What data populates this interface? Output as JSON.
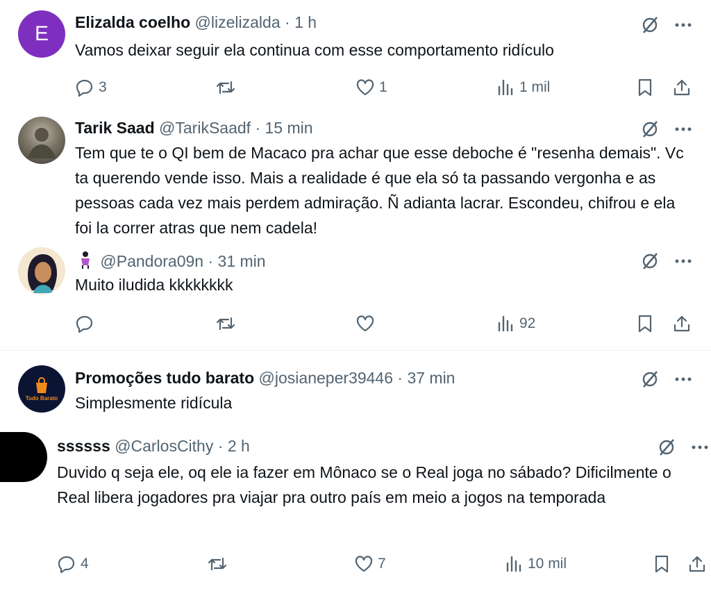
{
  "colors": {
    "text": "#0f1419",
    "muted": "#536471",
    "purple_avatar": "#7e2fbf"
  },
  "posts": [
    {
      "name": "Elizalda coelho",
      "handle": "@lizelizalda",
      "dot": "·",
      "time": "1 h",
      "avatar_letter": "E",
      "text": "Vamos deixar seguir ela continua com esse comportamento ridículo",
      "replies": "3",
      "reposts": "",
      "likes": "1",
      "views": "1 mil"
    },
    {
      "name": "Tarik Saad",
      "handle": "@TarikSaadf",
      "dot": "·",
      "time": "15 min",
      "text": "Tem que te o QI bem de Macaco pra achar que esse deboche é \"resenha demais\". Vc ta querendo vende isso. Mais a realidade é que ela só ta passando vergonha e as pessoas cada vez mais perdem admiração. Ñ adianta lacrar. Escondeu, chifrou e ela foi la correr atras que nem cadela!"
    },
    {
      "name": "",
      "handle": "@Pandora09n",
      "dot": "·",
      "time": "31 min",
      "text": "Muito iludida kkkkkkkk",
      "replies": "",
      "reposts": "",
      "likes": "",
      "views": "92"
    },
    {
      "name": "Promoções tudo barato",
      "handle": "@josianeper39446",
      "dot": "·",
      "time": "37 min",
      "avatar_text": "Tudo Barato",
      "text": "Simplesmente ridícula"
    },
    {
      "name": "ssssss",
      "handle": "@CarlosCithy",
      "dot": "·",
      "time": "2 h",
      "text": "Duvido q seja ele, oq ele ia fazer em Mônaco se o Real joga no sábado? Dificilmente o Real libera jogadores pra viajar pra outro país em meio a jogos na temporada",
      "replies": "4",
      "reposts": "",
      "likes": "7",
      "views": "10 mil"
    }
  ]
}
